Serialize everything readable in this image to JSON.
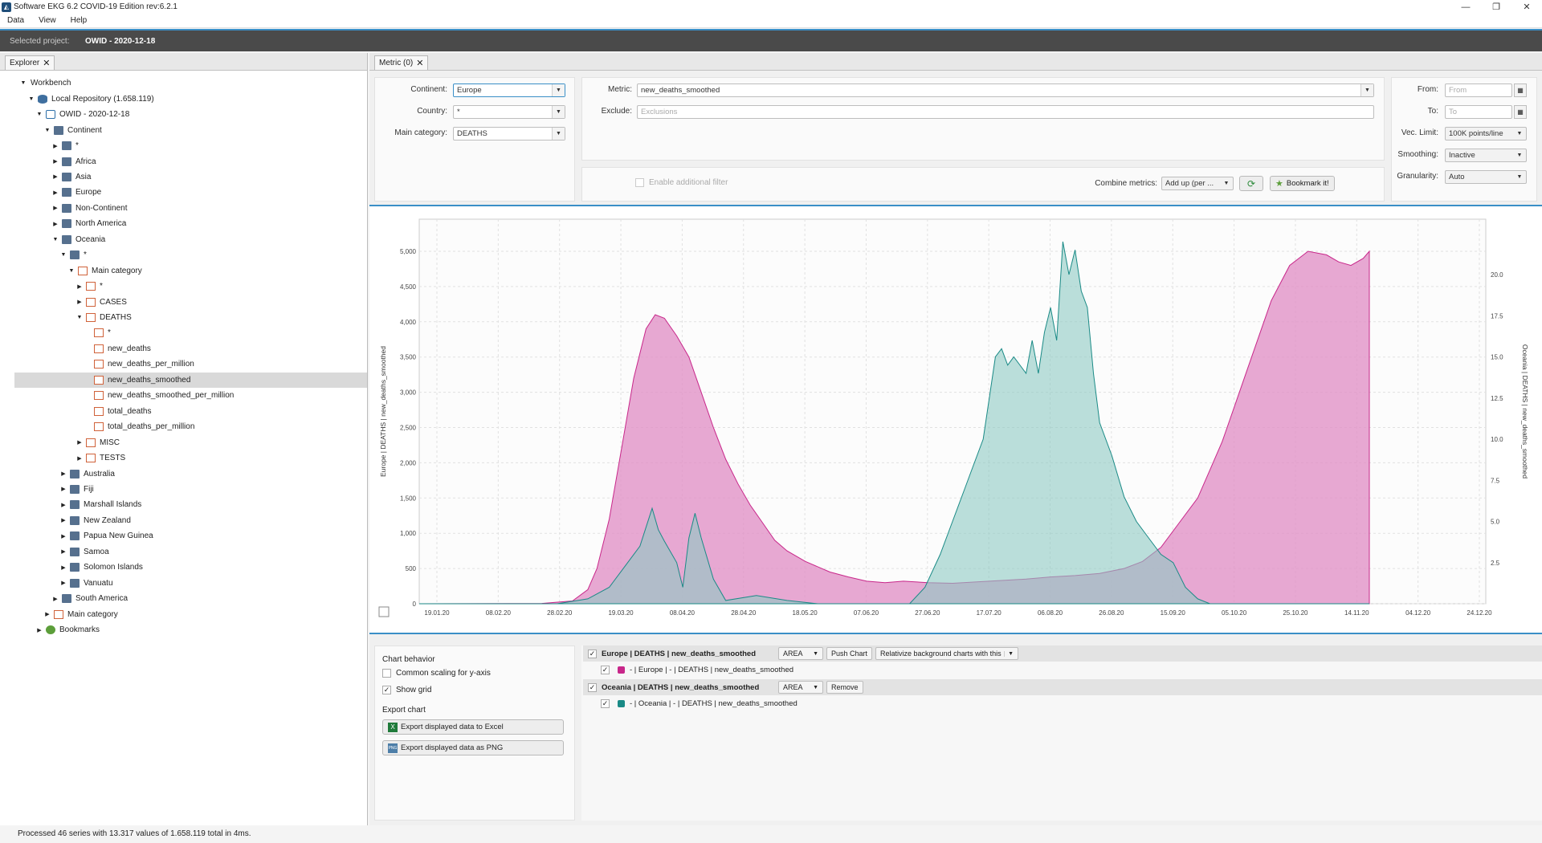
{
  "window": {
    "title": "Software EKG 6.2 COVID-19 Edition rev:6.2.1"
  },
  "menu": [
    "Data",
    "View",
    "Help"
  ],
  "project": {
    "label": "Selected project:",
    "value": "OWID - 2020-12-18"
  },
  "explorer": {
    "tab": "Explorer",
    "tree": [
      "Workbench",
      "Local Repository (1.658.119)",
      "OWID - 2020-12-18",
      "Continent",
      "*",
      "Africa",
      "Asia",
      "Europe",
      "Non-Continent",
      "North America",
      "Oceania",
      "*",
      "Main category",
      "*",
      "CASES",
      "DEATHS",
      "*",
      "new_deaths",
      "new_deaths_per_million",
      "new_deaths_smoothed",
      "new_deaths_smoothed_per_million",
      "total_deaths",
      "total_deaths_per_million",
      "MISC",
      "TESTS",
      "Australia",
      "Fiji",
      "Marshall Islands",
      "New Zealand",
      "Papua New Guinea",
      "Samoa",
      "Solomon Islands",
      "Vanuatu",
      "South America",
      "Main category",
      "Bookmarks"
    ]
  },
  "metric": {
    "tab": "Metric (0)",
    "continent_label": "Continent:",
    "continent": "Europe",
    "country_label": "Country:",
    "country": "*",
    "main_category_label": "Main category:",
    "main_category": "DEATHS",
    "metric_label": "Metric:",
    "metric": "new_deaths_smoothed",
    "exclude_label": "Exclude:",
    "exclude_placeholder": "Exclusions",
    "additional_filter": "Enable additional filter",
    "combine_label": "Combine metrics:",
    "combine": "Add up (per ...",
    "bookmark": "Bookmark it!",
    "from_label": "From:",
    "from_placeholder": "From",
    "to_label": "To:",
    "to_placeholder": "To",
    "vec_limit_label": "Vec. Limit:",
    "vec_limit": "100K points/line",
    "smoothing_label": "Smoothing:",
    "smoothing": "Inactive",
    "granularity_label": "Granularity:",
    "granularity": "Auto"
  },
  "chart_data": {
    "type": "area",
    "ylabel_left": "Europe | DEATHS | new_deaths_smoothed",
    "ylabel_right": "Oceania | DEATHS | new_deaths_smoothed",
    "xticks": [
      "19.01.20",
      "08.02.20",
      "28.02.20",
      "19.03.20",
      "08.04.20",
      "28.04.20",
      "18.05.20",
      "07.06.20",
      "27.06.20",
      "17.07.20",
      "06.08.20",
      "26.08.20",
      "15.09.20",
      "05.10.20",
      "25.10.20",
      "14.11.20",
      "04.12.20",
      "24.12.20"
    ],
    "yticks_left": [
      "0",
      "500",
      "1,000",
      "1,500",
      "2,000",
      "2,500",
      "3,000",
      "3,500",
      "4,000",
      "4,500",
      "5,000"
    ],
    "yticks_right": [
      "2.5",
      "5.0",
      "7.5",
      "10.0",
      "12.5",
      "15.0",
      "17.5",
      "20.0"
    ],
    "ylim_left": [
      0,
      5000
    ],
    "ylim_right": [
      0,
      20
    ],
    "x_unit": "days since 19.01.20",
    "series": [
      {
        "name": "Europe | DEATHS | new_deaths_smoothed",
        "color": "#e08cc4",
        "axis": "left",
        "points": [
          [
            0,
            0
          ],
          [
            40,
            5
          ],
          [
            50,
            40
          ],
          [
            55,
            200
          ],
          [
            58,
            500
          ],
          [
            62,
            1200
          ],
          [
            66,
            2200
          ],
          [
            70,
            3200
          ],
          [
            74,
            3900
          ],
          [
            77,
            4100
          ],
          [
            80,
            4050
          ],
          [
            84,
            3800
          ],
          [
            88,
            3500
          ],
          [
            92,
            3000
          ],
          [
            96,
            2500
          ],
          [
            100,
            2050
          ],
          [
            104,
            1700
          ],
          [
            108,
            1400
          ],
          [
            112,
            1150
          ],
          [
            116,
            900
          ],
          [
            120,
            750
          ],
          [
            126,
            600
          ],
          [
            134,
            450
          ],
          [
            140,
            380
          ],
          [
            146,
            320
          ],
          [
            152,
            300
          ],
          [
            158,
            320
          ],
          [
            166,
            300
          ],
          [
            174,
            290
          ],
          [
            182,
            310
          ],
          [
            190,
            330
          ],
          [
            198,
            350
          ],
          [
            206,
            380
          ],
          [
            214,
            400
          ],
          [
            222,
            430
          ],
          [
            230,
            500
          ],
          [
            236,
            600
          ],
          [
            242,
            800
          ],
          [
            248,
            1150
          ],
          [
            254,
            1500
          ],
          [
            258,
            1900
          ],
          [
            262,
            2300
          ],
          [
            266,
            2800
          ],
          [
            270,
            3300
          ],
          [
            274,
            3800
          ],
          [
            278,
            4300
          ],
          [
            284,
            4800
          ],
          [
            290,
            5000
          ],
          [
            296,
            4950
          ],
          [
            300,
            4850
          ],
          [
            304,
            4800
          ],
          [
            308,
            4900
          ],
          [
            310,
            5000
          ],
          [
            310,
            0
          ]
        ]
      },
      {
        "name": "Oceania | DEATHS | new_deaths_smoothed",
        "color": "#8ec9c3",
        "axis": "right",
        "points": [
          [
            0,
            0
          ],
          [
            45,
            0
          ],
          [
            55,
            0.3
          ],
          [
            62,
            1
          ],
          [
            68,
            2.5
          ],
          [
            72,
            3.5
          ],
          [
            76,
            5.8
          ],
          [
            78,
            4.5
          ],
          [
            80,
            3.8
          ],
          [
            84,
            2.5
          ],
          [
            86,
            1
          ],
          [
            88,
            4
          ],
          [
            90,
            5.5
          ],
          [
            92,
            4
          ],
          [
            96,
            1.5
          ],
          [
            100,
            0.2
          ],
          [
            110,
            0.5
          ],
          [
            120,
            0.2
          ],
          [
            130,
            0
          ],
          [
            150,
            0
          ],
          [
            160,
            0
          ],
          [
            165,
            1
          ],
          [
            170,
            3
          ],
          [
            174,
            5
          ],
          [
            178,
            7
          ],
          [
            180,
            8
          ],
          [
            184,
            10
          ],
          [
            186,
            12.5
          ],
          [
            188,
            15
          ],
          [
            190,
            15.5
          ],
          [
            192,
            14.5
          ],
          [
            194,
            15
          ],
          [
            198,
            14
          ],
          [
            200,
            16
          ],
          [
            202,
            14
          ],
          [
            204,
            16.5
          ],
          [
            206,
            18
          ],
          [
            208,
            16
          ],
          [
            210,
            22
          ],
          [
            212,
            20
          ],
          [
            214,
            21.5
          ],
          [
            216,
            19
          ],
          [
            218,
            18
          ],
          [
            220,
            14
          ],
          [
            222,
            11
          ],
          [
            226,
            9
          ],
          [
            230,
            6.5
          ],
          [
            234,
            5
          ],
          [
            238,
            4
          ],
          [
            242,
            3
          ],
          [
            246,
            2.5
          ],
          [
            250,
            1
          ],
          [
            254,
            0.3
          ],
          [
            258,
            0
          ],
          [
            310,
            0
          ]
        ]
      }
    ]
  },
  "chart_behavior": {
    "title": "Chart behavior",
    "common_scaling": "Common scaling for y-axis",
    "show_grid": "Show grid",
    "export_title": "Export chart",
    "export_excel": "Export displayed data to Excel",
    "export_png": "Export displayed data as PNG"
  },
  "series_list": [
    {
      "header": "Europe | DEATHS | new_deaths_smoothed",
      "type": "AREA",
      "action": "Push Chart",
      "extra": "Relativize background charts with this",
      "sub": "- | Europe | - | DEATHS | new_deaths_smoothed",
      "color": "#c8278a"
    },
    {
      "header": "Oceania | DEATHS | new_deaths_smoothed",
      "type": "AREA",
      "action": "Remove",
      "sub": "- | Oceania | - | DEATHS | new_deaths_smoothed",
      "color": "#1a8a86"
    }
  ],
  "status": "Processed 46 series with 13.317 values of 1.658.119 total in 4ms."
}
